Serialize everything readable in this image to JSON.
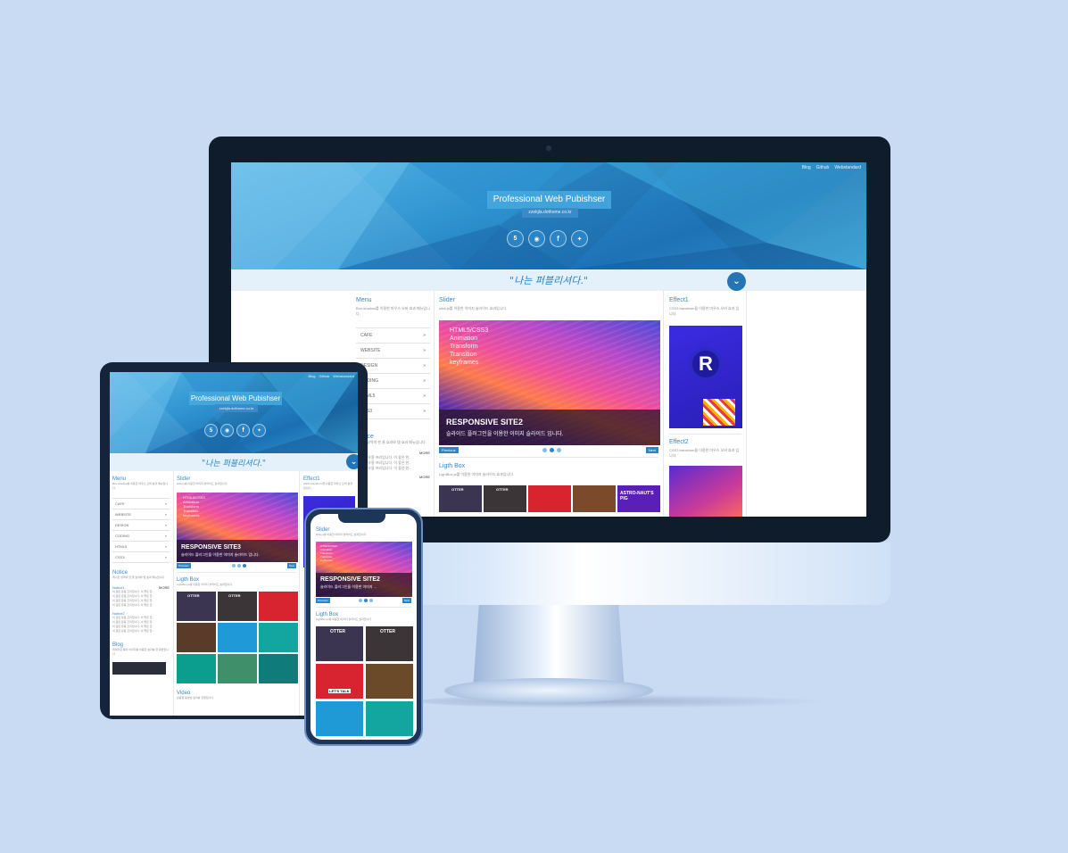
{
  "site": {
    "top_links": [
      "Blog",
      "Github",
      "Webstandard"
    ],
    "hero_title": "Professional Web Pubishser",
    "hero_sub": "zzekjla.dothome.co.kr",
    "social_icons": [
      "html5-icon",
      "github-icon",
      "facebook-icon",
      "twitter-icon"
    ],
    "band_text": "\"나는 퍼블리셔다.\"",
    "menu": {
      "title": "Menu",
      "desc": "Box-shadow를 이용한 마우스 오버 효과 메뉴입니다.",
      "items": [
        "CAFE",
        "WEBSITE",
        "DESIGN",
        "CODING",
        "HTML5",
        "CSS3"
      ],
      "arrow": "»"
    },
    "slider": {
      "title": "Slider",
      "desc": "slick.js를 이용한 이미지 슬라이드 효과입니다.",
      "lines": [
        "HTML5/CSS3",
        "Animation",
        "Transform",
        "Transition",
        "keyframes"
      ],
      "caption_title_monitor": "RESPONSIVE SITE2",
      "caption_title_tablet": "RESPONSIVE SITE3",
      "caption_title_phone": "RESPONSIVE SITE2",
      "caption_text": "슬라이드 플러그인을 이용한 이미지 슬라이드 입니다.",
      "caption_text_phone": "슬라이드 플러그인을 이용한 이미지 ...",
      "prev": "Previous",
      "next": "Next"
    },
    "lightbox": {
      "title": "Ligth Box",
      "desc": "LightBox.js를 이용한 이미지 슬라이드 효과입니다.",
      "astro": "ASTRO-NAUT'S PIG",
      "otter": "OTTER",
      "letstalk": "LET'S TALK"
    },
    "effect1": {
      "title": "Effect1",
      "desc": "CSS3 transform을 이용한 마우스 오버 효과 입니다."
    },
    "effect2": {
      "title": "Effect2",
      "desc": "CSS3 transform을 이용한 마우스 오버 효과 입니다."
    },
    "notice": {
      "title": "Notice",
      "desc": "게시판 영역의 한 줄 효과와 탭 효과 메뉴입니다.",
      "tab1": "Notice1",
      "tab2": "Notice2",
      "more": "MORE",
      "line": "이 글은 유용 프리입니다. 이 좋은 한..."
    },
    "blog": {
      "title": "Blog",
      "desc": "레이아웃 틀이 이미지를 이용한 효과를 한 화면입니다."
    },
    "video": {
      "title": "Video",
      "desc": "반응형 동영상 효과를 진행입니다."
    }
  },
  "colors": {
    "page_bg": "#c9daf3",
    "accent": "#2a86c8",
    "band": "#e4f1fa"
  }
}
